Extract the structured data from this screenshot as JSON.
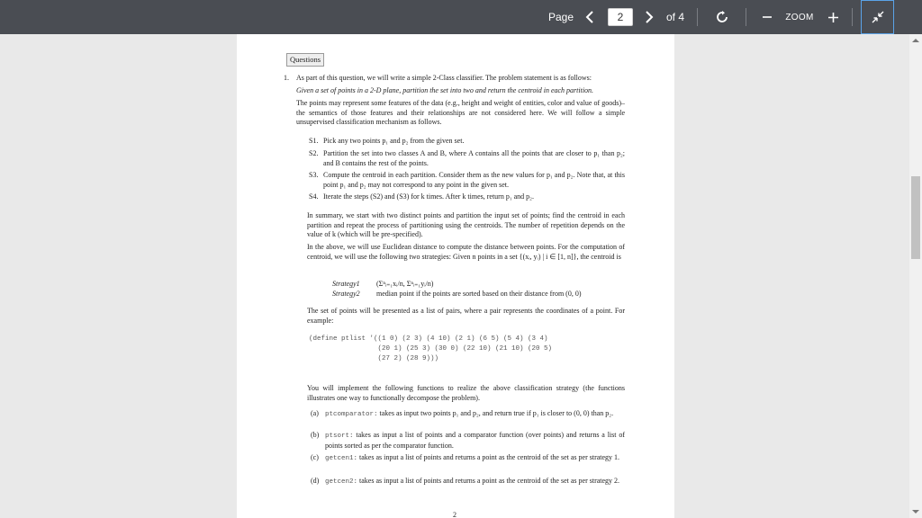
{
  "toolbar": {
    "page_label": "Page",
    "current_page": "2",
    "of_label": "of 4",
    "zoom_label": "ZOOM",
    "prev_icon": "‹",
    "next_icon": "›",
    "zoom_out_icon": "—",
    "zoom_in_icon": "+"
  },
  "document": {
    "section_heading": "Questions",
    "q1_number": "1.",
    "q1_intro": "As part of this question, we will write a simple 2-Class classifier. The problem statement is as follows:",
    "q1_statement": "Given a set of points in a 2-D plane, partition the set into two and return the centroid in each partition.",
    "q1_para": "The points may represent some features of the data (e.g., height and weight of entities, color and value of goods)–the semantics of those features and their relationships are not considered here. We will follow a simple unsupervised classification mechanism as follows.",
    "steps": [
      {
        "label": "S1.",
        "text": "Pick any two points p₁ and p₂ from the given set."
      },
      {
        "label": "S2.",
        "text": "Partition the set into two classes A and B, where A contains all the points that are closer to p₁ than p₂; and B contains the rest of the points."
      },
      {
        "label": "S3.",
        "text": "Compute the centroid in each partition. Consider them as the new values for p₁ and p₂. Note that, at this point p₁ and p₂ may not correspond to any point in the given set."
      },
      {
        "label": "S4.",
        "text": "Iterate the steps (S2) and (S3) for k times. After k times, return p₁ and p₂."
      }
    ],
    "summary_para": "In summary, we start with two distinct points and partition the input set of points; find the centroid in each partition and repeat the process of partitioning using the centroids. The number of repetition depends on the value of k (which will be pre-specified).",
    "distance_para": "In the above, we will use Euclidean distance to compute the distance between points. For the computation of centroid, we will use the following two strategies: Given n points in a set {(xᵢ, yᵢ) | i ∈ [1, n]}, the centroid is",
    "strategies": [
      {
        "name": "Strategy1",
        "text": "(Σⁿᵢ₌₁xᵢ/n, Σⁿᵢ₌₁yᵢ/n)"
      },
      {
        "name": "Strategy2",
        "text": "median point if the points are sorted based on their distance from (0, 0)"
      }
    ],
    "points_para": "The set of points will be presented as a list of pairs, where a pair represents the coordinates of a point. For example:",
    "code_lines": [
      "(define ptlist '((1 0) (2 3) (4 10) (2 1) (6 5) (5 4) (3 4)",
      "                 (20 1) (25 3) (30 0) (22 10) (21 10) (20 5)",
      "                 (27 2) (28 9)))"
    ],
    "functions_para": "You will implement the following functions to realize the above classification strategy (the functions illustrates one way to functionally decompose the problem).",
    "functions": [
      {
        "label": "(a)",
        "name": "ptcomparator:",
        "text": "takes as input two points p₁ and p₂, and return true if p₁ is closer to (0, 0) than p₂."
      },
      {
        "label": "(b)",
        "name": "ptsort:",
        "text": "takes as input a list of points and a comparator function (over points) and returns a list of points sorted as per the comparator function."
      },
      {
        "label": "(c)",
        "name": "getcen1:",
        "text": "takes as input a list of points and returns a point as the centroid of the set as per strategy 1."
      },
      {
        "label": "(d)",
        "name": "getcen2:",
        "text": "takes as input a list of points and returns a point as the centroid of the set as per strategy 2."
      }
    ],
    "page_number": "2"
  }
}
